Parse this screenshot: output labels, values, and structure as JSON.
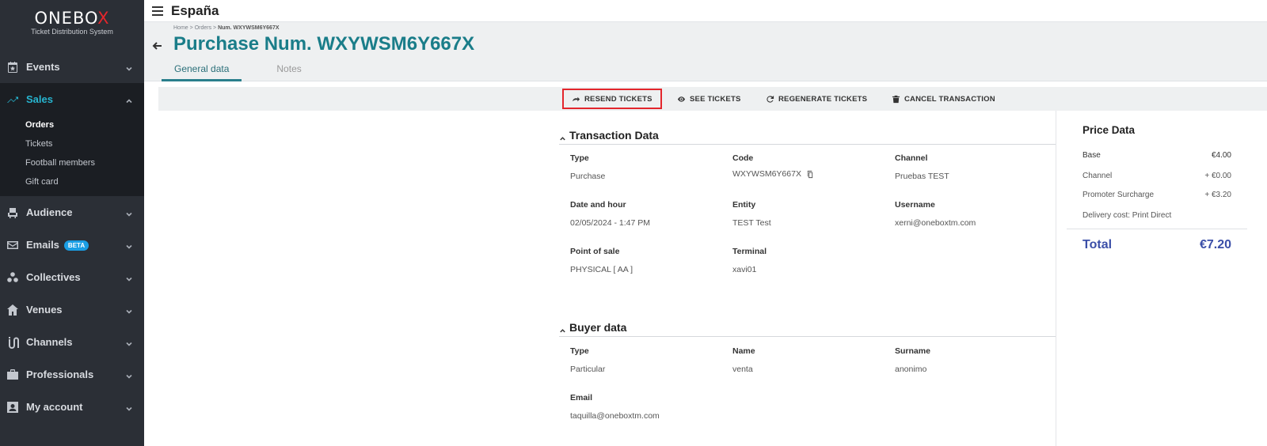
{
  "sidebar": {
    "logo_prefix": "ONEBO",
    "logo_x": "X",
    "logo_subtitle": "Ticket Distribution System",
    "items": [
      {
        "label": "Events",
        "icon": "calendar-star-icon"
      },
      {
        "label": "Sales",
        "icon": "trending-up-icon"
      },
      {
        "label": "Audience",
        "icon": "seat-icon"
      },
      {
        "label": "Emails",
        "icon": "mail-icon",
        "badge": "BETA"
      },
      {
        "label": "Collectives",
        "icon": "group-icon"
      },
      {
        "label": "Venues",
        "icon": "house-icon"
      },
      {
        "label": "Channels",
        "icon": "route-icon"
      },
      {
        "label": "Professionals",
        "icon": "briefcase-icon"
      },
      {
        "label": "My account",
        "icon": "account-box-icon"
      }
    ],
    "sales_sub": [
      "Orders",
      "Tickets",
      "Football members",
      "Gift card"
    ]
  },
  "topbar": {
    "country": "España"
  },
  "header": {
    "breadcrumb_home": "Home",
    "breadcrumb_sep1": ">",
    "breadcrumb_orders": "Orders",
    "breadcrumb_sep2": ">",
    "breadcrumb_current": "Num. WXYWSM6Y667X",
    "title": "Purchase Num. WXYWSM6Y667X",
    "tabs": [
      "General data",
      "Notes"
    ]
  },
  "toolbar": {
    "resend": "RESEND TICKETS",
    "see": "SEE TICKETS",
    "regenerate": "REGENERATE TICKETS",
    "cancel": "CANCEL TRANSACTION"
  },
  "transaction": {
    "title": "Transaction Data",
    "fields": [
      {
        "label": "Type",
        "value": "Purchase"
      },
      {
        "label": "Code",
        "value": "WXYWSM6Y667X"
      },
      {
        "label": "Channel",
        "value": "Pruebas TEST"
      },
      {
        "label": "Date and hour",
        "value": "02/05/2024 - 1:47 PM"
      },
      {
        "label": "Entity",
        "value": "TEST Test"
      },
      {
        "label": "Username",
        "value": "xerni@oneboxtm.com"
      },
      {
        "label": "Point of sale",
        "value": "PHYSICAL [ AA ]"
      },
      {
        "label": "Terminal",
        "value": "xavi01"
      }
    ]
  },
  "buyer": {
    "title": "Buyer data",
    "fields": [
      {
        "label": "Type",
        "value": "Particular"
      },
      {
        "label": "Name",
        "value": "venta"
      },
      {
        "label": "Surname",
        "value": "anonimo"
      },
      {
        "label": "Email",
        "value": "taquilla@oneboxtm.com"
      }
    ]
  },
  "price": {
    "title": "Price Data",
    "rows": [
      {
        "label": "Base",
        "value": "€4.00"
      },
      {
        "label": "Channel",
        "value": "+ €0.00"
      },
      {
        "label": "Promoter Surcharge",
        "value": "+ €3.20"
      },
      {
        "label": "Delivery cost: Print Direct",
        "value": ""
      }
    ],
    "total_label": "Total",
    "total_value": "€7.20"
  },
  "colors": {
    "accent": "#1a7d89",
    "sales_active": "#27b5d0",
    "highlight": "#e3262c",
    "total": "#3b4fa8"
  }
}
